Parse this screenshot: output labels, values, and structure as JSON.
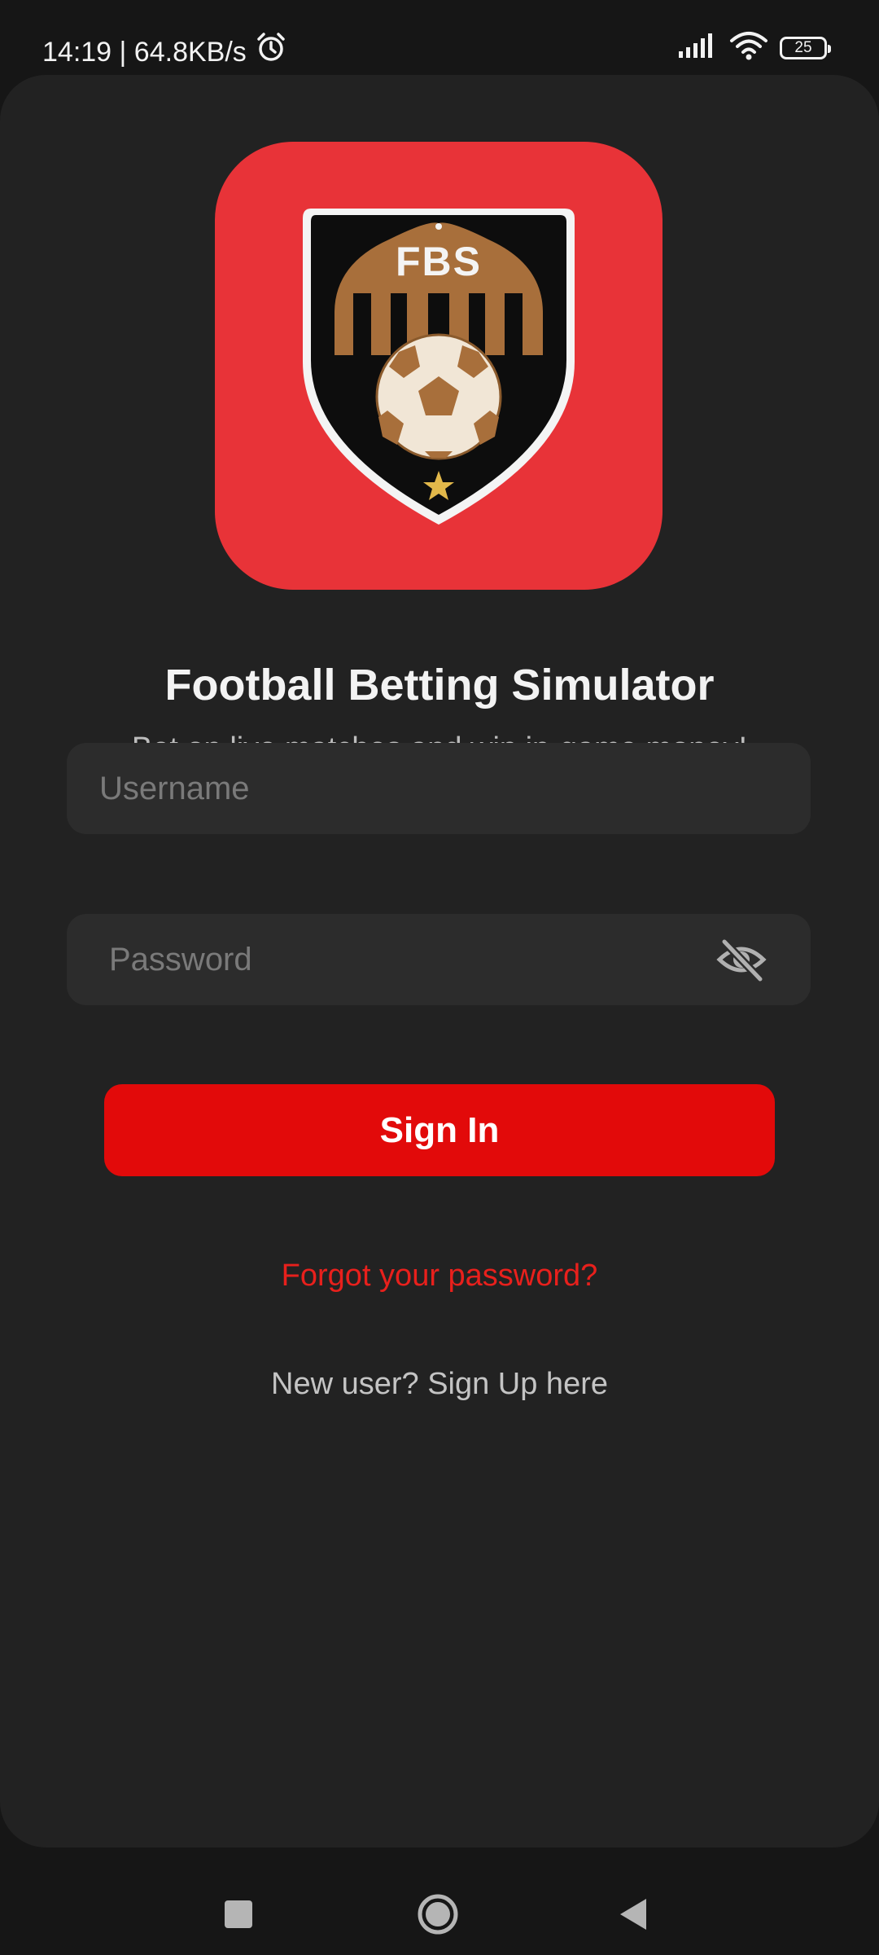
{
  "status_bar": {
    "time_speed": "14:19 | 64.8KB/s",
    "battery_level": "25"
  },
  "logo": {
    "text": "FBS",
    "tile_color": "#e83338",
    "accent_color": "#a86f3b"
  },
  "app": {
    "title": "Football Betting Simulator",
    "subtitle": "Bet on live matches and win in-game money!"
  },
  "form": {
    "username_placeholder": "Username",
    "password_placeholder": "Password",
    "signin_label": "Sign In",
    "forgot_label": "Forgot your password?",
    "signup_label": "New user? Sign Up here"
  },
  "colors": {
    "accent_red": "#e20a0a",
    "link_red": "#e8201c",
    "background": "#222222"
  }
}
